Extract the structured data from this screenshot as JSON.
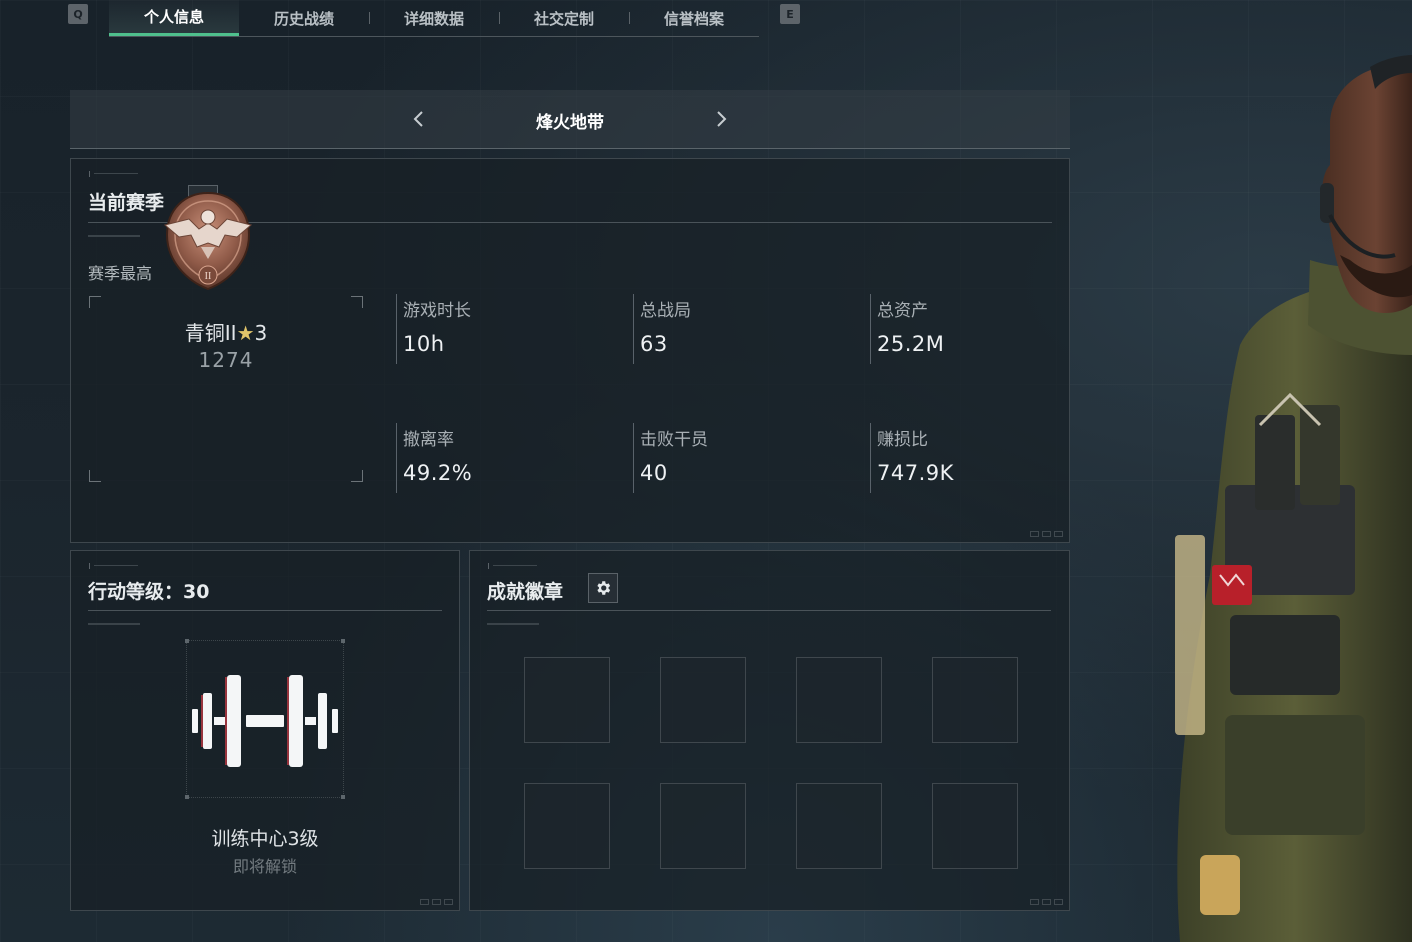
{
  "top_nav": {
    "prev_key": "Q",
    "next_key": "E",
    "tabs": [
      {
        "label": "个人信息",
        "active": true
      },
      {
        "label": "历史战绩",
        "active": false
      },
      {
        "label": "详细数据",
        "active": false
      },
      {
        "label": "社交定制",
        "active": false
      },
      {
        "label": "信誉档案",
        "active": false
      }
    ]
  },
  "mode_selector": {
    "title": "烽火地带",
    "prev_icon": "chevron-left-icon",
    "next_icon": "chevron-right-icon"
  },
  "season": {
    "title": "当前赛季",
    "switch_icon": "swap-arrows-icon",
    "best_label": "赛季最高",
    "rank": {
      "name": "青铜II",
      "stars": "3",
      "star_icon": "star-icon",
      "score": "1274",
      "badge_numeral": "II",
      "badge_icon": "bronze-eagle-rank-badge-icon"
    },
    "stats": [
      {
        "label": "游戏时长",
        "value": "10h"
      },
      {
        "label": "总战局",
        "value": "63"
      },
      {
        "label": "总资产",
        "value": "25.2M"
      },
      {
        "label": "撤离率",
        "value": "49.2%"
      },
      {
        "label": "击败干员",
        "value": "40"
      },
      {
        "label": "赚损比",
        "value": "747.9K"
      }
    ]
  },
  "level": {
    "title": "行动等级：30",
    "icon": "dumbbell-icon",
    "caption": "训练中心3级",
    "status": "即将解锁"
  },
  "achievements": {
    "title": "成就徽章",
    "settings_icon": "gear-icon",
    "slots": 8
  },
  "colors": {
    "accent": "#4fc08d",
    "panel_border": "#3e474d",
    "background": "#1b252d",
    "rank_star": "#e0c46a"
  }
}
